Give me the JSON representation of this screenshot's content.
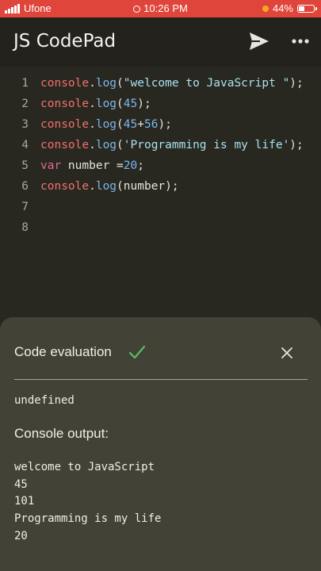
{
  "status_bar": {
    "carrier": "Ufone",
    "time": "10:26 PM",
    "battery": "44%",
    "battery_level": 0.44
  },
  "app_bar": {
    "title": "JS CodePad",
    "icons": [
      "send-icon",
      "more-icon"
    ]
  },
  "editor": {
    "lines": [
      {
        "num": "1",
        "tokens": [
          {
            "t": "console",
            "c": "obj"
          },
          {
            "t": ".",
            "c": "pl"
          },
          {
            "t": "log",
            "c": "fn"
          },
          {
            "t": "(",
            "c": "pl"
          },
          {
            "t": "\"welcome to JavaScript \"",
            "c": "str"
          },
          {
            "t": ");",
            "c": "pl"
          }
        ]
      },
      {
        "num": "2",
        "tokens": [
          {
            "t": "console",
            "c": "obj"
          },
          {
            "t": ".",
            "c": "pl"
          },
          {
            "t": "log",
            "c": "fn"
          },
          {
            "t": "(",
            "c": "pl"
          },
          {
            "t": "45",
            "c": "num"
          },
          {
            "t": ");",
            "c": "pl"
          }
        ]
      },
      {
        "num": "3",
        "tokens": [
          {
            "t": "console",
            "c": "obj"
          },
          {
            "t": ".",
            "c": "pl"
          },
          {
            "t": "log",
            "c": "fn"
          },
          {
            "t": "(",
            "c": "pl"
          },
          {
            "t": "45",
            "c": "num"
          },
          {
            "t": "+",
            "c": "pl"
          },
          {
            "t": "56",
            "c": "num"
          },
          {
            "t": ");",
            "c": "pl"
          }
        ]
      },
      {
        "num": "4",
        "tokens": [
          {
            "t": "console",
            "c": "obj"
          },
          {
            "t": ".",
            "c": "pl"
          },
          {
            "t": "log",
            "c": "fn"
          },
          {
            "t": "(",
            "c": "pl"
          },
          {
            "t": "'Programming is my life'",
            "c": "str"
          },
          {
            "t": ");",
            "c": "pl"
          }
        ]
      },
      {
        "num": "5",
        "tokens": [
          {
            "t": "var",
            "c": "kw"
          },
          {
            "t": " number =",
            "c": "pl"
          },
          {
            "t": "20",
            "c": "num"
          },
          {
            "t": ";",
            "c": "pl"
          }
        ]
      },
      {
        "num": "6",
        "tokens": [
          {
            "t": "console",
            "c": "obj"
          },
          {
            "t": ".",
            "c": "pl"
          },
          {
            "t": "log",
            "c": "fn"
          },
          {
            "t": "(number);",
            "c": "pl"
          }
        ]
      },
      {
        "num": "7",
        "tokens": []
      },
      {
        "num": "8",
        "tokens": []
      }
    ]
  },
  "evaluation": {
    "heading": "Code evaluation",
    "status_icon": "checkmark-icon",
    "close_icon": "close-icon",
    "result": "undefined",
    "console_label": "Console output:",
    "console_lines": [
      "welcome to JavaScript",
      "45",
      "101",
      "Programming is my life",
      "20"
    ]
  },
  "colors": {
    "status_bar": "#e0453b",
    "background": "#22211c",
    "editor": "#292820",
    "sheet": "#434237",
    "check": "#5dbb63"
  }
}
